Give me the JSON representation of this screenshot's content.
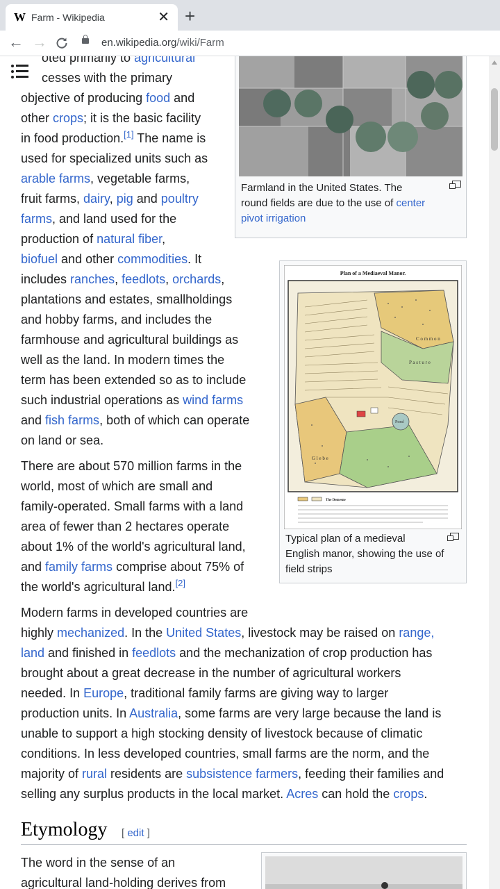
{
  "browser": {
    "tab_title": "Farm - Wikipedia",
    "favicon": "W",
    "new_tab": "+",
    "close": "✕",
    "back": "←",
    "forward": "→",
    "reload": "C",
    "url_main": "en.wikipedia.org",
    "url_path": "/wiki/Farm"
  },
  "article": {
    "p1": {
      "l1a": "oted primarily to ",
      "l1b": "agricultural",
      "l2": "cesses with the primary",
      "l3a": "objective of producing ",
      "l3b": "food",
      "l3c": " and",
      "l4a": "other ",
      "l4b": "crops",
      "l4c": "; it is the basic facility",
      "l5a": "in food production.",
      "l5sup": "[1]",
      "l5b": " The name is",
      "l6": "used for specialized units such as",
      "l7a": "arable farms",
      "l7b": ", vegetable farms,",
      "l8a": "fruit farms, ",
      "l8b": "dairy",
      "l8c": ", ",
      "l8d": "pig",
      "l8e": " and ",
      "l8f": "poultry",
      "l9a": "farms",
      "l9b": ", and land used for the",
      "l10a": "production of ",
      "l10b": "natural fiber",
      "l11a": "biofuel",
      "l11b": " and other ",
      "l11c": "commodities",
      "l11d": ". It",
      "l12a": "includes ",
      "l12b": "ranches",
      "l12c": ", ",
      "l12d": "feedlots",
      "l12e": ", ",
      "l12f": "orchards",
      "l12g": ",",
      "l13": "plantations and estates, smallholdings",
      "l14": "and hobby farms, and includes the",
      "l15": "farmhouse and agricultural buildings as",
      "l16": "well as the land. In modern times the",
      "l17": "term has been extended so as to include",
      "l18a": "such industrial operations as ",
      "l18b": "wind farms",
      "l19a": "and ",
      "l19b": "fish farms",
      "l19c": ", both of which can operate",
      "l20": "on land or sea."
    },
    "p2": {
      "l1": "There are about 570 million farms in the",
      "l2": "world, most of which are small and",
      "l3": "family-operated. Small farms with a land",
      "l4": "area of fewer than 2 hectares operate",
      "l5": "about 1% of the world's agricultural land,",
      "l6a": "and ",
      "l6b": "family farms",
      "l6c": " comprise about 75% of",
      "l7": "the world's agricultural land.",
      "l7sup": "[2]"
    },
    "p3": {
      "l1": "Modern farms in developed countries are",
      "l2a": "highly ",
      "l2b": "mechanized",
      "l2c": ". In the ",
      "l2d": "United States",
      "l2e": ", livestock may be raised on ",
      "l2f": "range,",
      "l3a": "land",
      "l3b": " and finished in ",
      "l3c": "feedlots",
      "l3d": " and the mechanization of crop production has",
      "l4": "brought about a great decrease in the number of agricultural workers",
      "l5a": "needed. In ",
      "l5b": "Europe",
      "l5c": ", traditional family farms are giving way to larger",
      "l6a": "production units. In ",
      "l6b": "Australia",
      "l6c": ", some farms are very large because the land is",
      "l7": "unable to support a high stocking density of livestock because of climatic",
      "l8": "conditions. In less developed countries, small farms are the norm, and the",
      "l9a": "majority of ",
      "l9b": "rural",
      "l9c": " residents are ",
      "l9d": "subsistence farmers",
      "l9e": ", feeding their families and",
      "l10a": "selling any surplus products in the local market. ",
      "l10b": "Acres",
      "l10c": " can hold the ",
      "l10d": "crops",
      "l10e": "."
    },
    "etymology": {
      "heading": "Etymology",
      "edit_open": "[ ",
      "edit": "edit",
      "edit_close": " ]",
      "l1": "The word in the sense of an",
      "l2": "agricultural land-holding derives from"
    },
    "figure1": {
      "caption_a": "Farmland in the United States. The",
      "caption_b": "round fields are due to the use of ",
      "caption_link1": "center",
      "caption_link2": "pivot irrigation"
    },
    "figure2": {
      "map_title": "Plan of a Mediaeval Manor.",
      "label_common": "C o m m o n",
      "label_pasture": "P a s t u r e",
      "label_pond": "Pond",
      "label_glebe": "G l e b e",
      "legend_demesne": "The Demesne",
      "caption_a": "Typical plan of a medieval",
      "caption_b": "English manor, showing the use of",
      "caption_c": "field strips"
    }
  }
}
